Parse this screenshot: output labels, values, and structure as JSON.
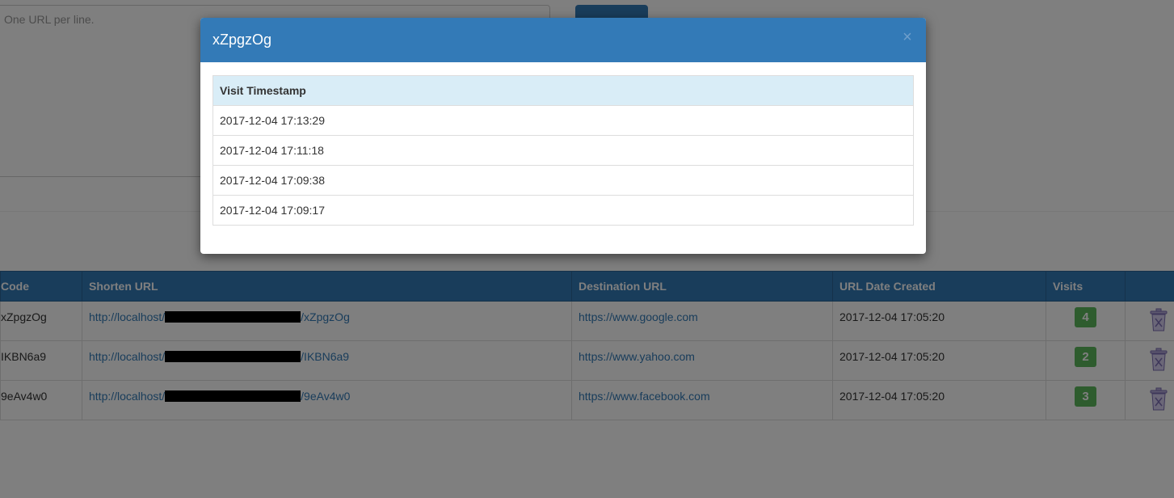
{
  "form": {
    "textarea_placeholder": "One URL per line.",
    "submit_label": ""
  },
  "table": {
    "headers": {
      "code": "Code",
      "shorten_url": "Shorten URL",
      "destination_url": "Destination URL",
      "date_created": "URL Date Created",
      "visits": "Visits",
      "actions": ""
    },
    "rows": [
      {
        "code": "xZpgzOg",
        "short_prefix": "http://localhost/",
        "short_suffix": "/xZpgzOg",
        "destination": "https://www.google.com",
        "created": "2017-12-04 17:05:20",
        "visits": "4"
      },
      {
        "code": "IKBN6a9",
        "short_prefix": "http://localhost/",
        "short_suffix": "/IKBN6a9",
        "destination": "https://www.yahoo.com",
        "created": "2017-12-04 17:05:20",
        "visits": "2"
      },
      {
        "code": "9eAv4w0",
        "short_prefix": "http://localhost/",
        "short_suffix": "/9eAv4w0",
        "destination": "https://www.facebook.com",
        "created": "2017-12-04 17:05:20",
        "visits": "3"
      }
    ]
  },
  "modal": {
    "title": "xZpgzOg",
    "close_symbol": "×",
    "column_header": "Visit Timestamp",
    "timestamps": [
      "2017-12-04 17:13:29",
      "2017-12-04 17:11:18",
      "2017-12-04 17:09:38",
      "2017-12-04 17:09:17"
    ]
  },
  "colors": {
    "primary": "#337ab7",
    "success_badge": "#5cb85c",
    "info_header": "#d9edf7",
    "backdrop": "rgba(0,0,0,0.5)"
  },
  "icons": {
    "delete": "trash-icon",
    "close": "close-icon"
  }
}
